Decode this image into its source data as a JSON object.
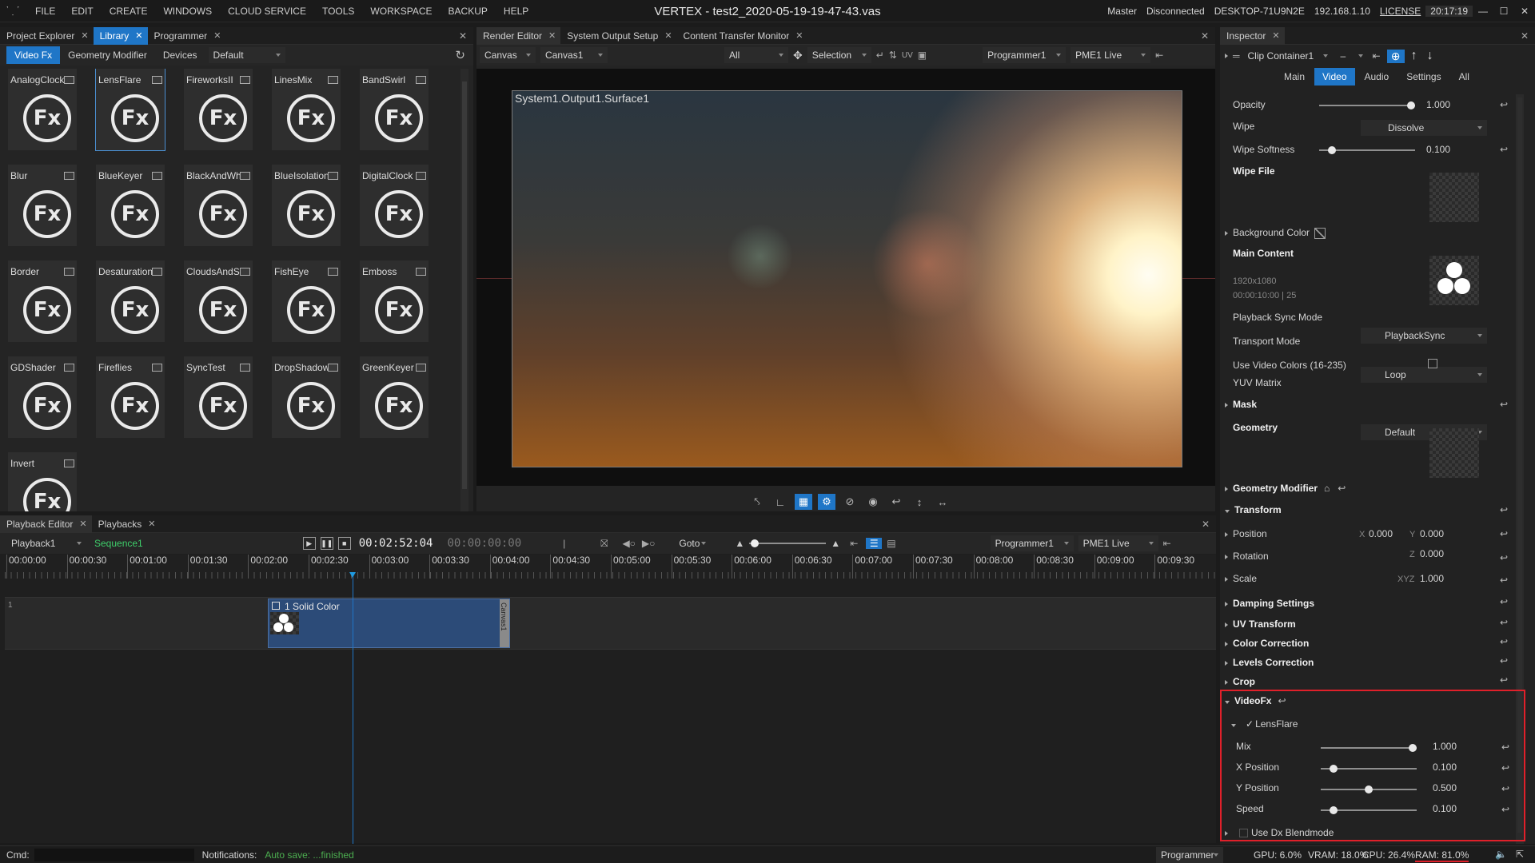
{
  "app": {
    "title": "VERTEX - test2_2020-05-19-19-47-43.vas",
    "menu": [
      "FILE",
      "EDIT",
      "CREATE",
      "WINDOWS",
      "CLOUD SERVICE",
      "TOOLS",
      "WORKSPACE",
      "BACKUP",
      "HELP"
    ],
    "status": {
      "role": "Master",
      "connection": "Disconnected",
      "host": "DESKTOP-71U9N2E",
      "ip": "192.168.1.10",
      "license": "LICENSE",
      "time": "20:17:19"
    }
  },
  "left_panel": {
    "tabs": [
      "Project Explorer",
      "Library",
      "Programmer"
    ],
    "subtabs": [
      "Video Fx",
      "Geometry Modifier",
      "Devices"
    ],
    "filter": "Default",
    "fx_glyph": "Fx",
    "effects": [
      "AnalogClock",
      "LensFlare",
      "FireworksII",
      "LinesMix",
      "BandSwirl",
      "Blur",
      "BlueKeyer",
      "BlackAndWhite",
      "BlueIsolation",
      "DigitalClock",
      "Border",
      "Desaturation",
      "CloudsAndSky",
      "FishEye",
      "Emboss",
      "GDShader",
      "Fireflies",
      "SyncTest",
      "DropShadow",
      "GreenKeyer",
      "Invert"
    ],
    "selected_effect": "LensFlare"
  },
  "center_panel": {
    "tabs": [
      "Render Editor",
      "System Output Setup",
      "Content Transfer Monitor"
    ],
    "toolbar": {
      "canvas_type": "Canvas",
      "canvas": "Canvas1",
      "filter": "All",
      "mode": "Selection",
      "programmer": "Programmer1",
      "live": "PME1 Live"
    },
    "surface_label": "System1.Output1.Surface1"
  },
  "playback": {
    "tabs": [
      "Playback Editor",
      "Playbacks"
    ],
    "playback": "Playback1",
    "sequence": "Sequence1",
    "timecode": "00:02:52:04",
    "timecode2": "00:00:00:00",
    "goto_label": "Goto",
    "programmer": "Programmer1",
    "live": "PME1 Live",
    "ruler": [
      "00:00:00",
      "00:00:30",
      "00:01:00",
      "00:01:30",
      "00:02:00",
      "00:02:30",
      "00:03:00",
      "00:03:30",
      "00:04:00",
      "00:04:30",
      "00:05:00",
      "00:05:30",
      "00:06:00",
      "00:06:30",
      "00:07:00",
      "00:07:30",
      "00:08:00",
      "00:08:30",
      "00:09:00",
      "00:09:30"
    ],
    "track_number": "1",
    "clip_label": "1 Solid Color",
    "clip_canvas": "Canvas1"
  },
  "inspector": {
    "tab": "Inspector",
    "target": "Clip Container1",
    "target_dash": "–",
    "subtabs": [
      "Main",
      "Video",
      "Audio",
      "Settings",
      "All"
    ],
    "opacity": {
      "label": "Opacity",
      "value": "1.000",
      "level": 1.0
    },
    "wipe": {
      "label": "Wipe",
      "value": "Dissolve"
    },
    "wipe_softness": {
      "label": "Wipe Softness",
      "value": "0.100",
      "level": 0.1
    },
    "wipe_file": "Wipe File",
    "background_color": "Background Color",
    "main_content": {
      "label": "Main Content",
      "resolution": "1920x1080",
      "duration": "00:00:10:00 | 25"
    },
    "playback_sync": {
      "label": "Playback Sync Mode",
      "value": "PlaybackSync"
    },
    "transport": {
      "label": "Transport Mode",
      "value": "Loop"
    },
    "video_colors": "Use Video Colors (16-235)",
    "yuv": {
      "label": "YUV Matrix",
      "value": "Default"
    },
    "mask": "Mask",
    "geometry": "Geometry",
    "geometry_modifier": "Geometry Modifier",
    "transform": "Transform",
    "position": {
      "label": "Position",
      "x_label": "X",
      "x": "0.000",
      "y_label": "Y",
      "y": "0.000"
    },
    "rotation": {
      "label": "Rotation",
      "z_label": "Z",
      "z": "0.000"
    },
    "scale": {
      "label": "Scale",
      "xyz_label": "XYZ",
      "value": "1.000"
    },
    "sections": [
      "Damping Settings",
      "UV Transform",
      "Color Correction",
      "Levels Correction",
      "Crop"
    ],
    "videofx": {
      "label": "VideoFx",
      "effect": "LensFlare",
      "params": [
        {
          "label": "Mix",
          "value": "1.000",
          "level": 1.0
        },
        {
          "label": "X Position",
          "value": "0.100",
          "level": 0.1
        },
        {
          "label": "Y Position",
          "value": "0.500",
          "level": 0.5
        },
        {
          "label": "Speed",
          "value": "0.100",
          "level": 0.1
        }
      ],
      "blendmode": "Use Dx Blendmode"
    }
  },
  "bottom": {
    "cmd_label": "Cmd:",
    "notifications_label": "Notifications:",
    "notification": "Auto save: ...finished",
    "mode": "Programmer",
    "gpu": "GPU: 6.0%",
    "vram": "VRAM: 18.0%",
    "cpu": "CPU: 26.4%",
    "ram": "RAM: 81.0%"
  },
  "colors": {
    "accent": "#1f76c7",
    "highlight_box": "#e0202a",
    "notification": "#4caf50",
    "sequence": "#3ecf6a"
  }
}
